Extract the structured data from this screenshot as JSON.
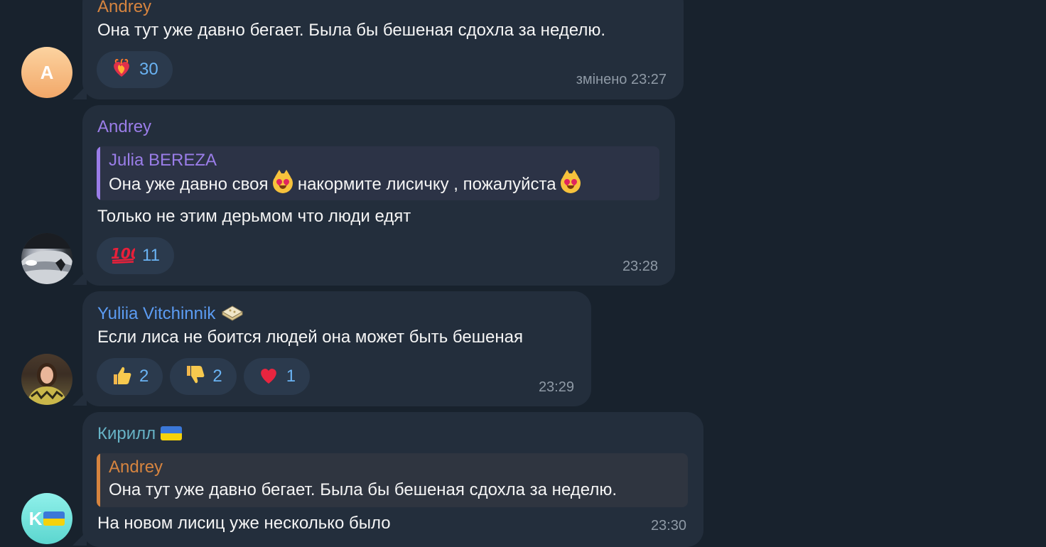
{
  "colors": {
    "background": "#18222d",
    "bubble": "#232e3c",
    "reaction_bg": "#2b3a4d",
    "reaction_count": "#6ab3f3",
    "time": "#8f9aa6",
    "sender_andrey_orange": "#d6843f",
    "sender_andrey_purple": "#9a7de8",
    "sender_yuliia": "#5c9cf3",
    "sender_kirill": "#67b3c6"
  },
  "messages": [
    {
      "sender": "Andrey",
      "text": "Она тут уже давно бегает. Была бы бешеная сдохла за неделю.",
      "avatar_letter": "A",
      "reactions": [
        {
          "emoji_icon": "burning-heart-icon",
          "emoji": "❤‍🔥",
          "count": "30"
        }
      ],
      "time": "змінено 23:27"
    },
    {
      "sender": "Andrey",
      "reply": {
        "author": "Julia BEREZA",
        "text_part1": "Она уже давно своя ",
        "text_part2": "накормите лисичку , пожалуйста "
      },
      "text": "Только не этим дерьмом что люди едят",
      "reactions": [
        {
          "emoji_icon": "hundred-points-icon",
          "emoji": "💯",
          "count": "11"
        }
      ],
      "time": "23:28"
    },
    {
      "sender": "Yuliia Vitchinnik",
      "sender_badge": "🫡",
      "text": "Если лиса не боится людей она может быть бешеная",
      "reactions": [
        {
          "emoji_icon": "thumbs-up-icon",
          "emoji": "👍",
          "count": "2"
        },
        {
          "emoji_icon": "thumbs-down-icon",
          "emoji": "👎",
          "count": "2"
        },
        {
          "emoji_icon": "red-heart-icon",
          "emoji": "❤️",
          "count": "1"
        }
      ],
      "time": "23:29"
    },
    {
      "sender": "Кирилл ",
      "reply": {
        "author": "Andrey",
        "text": "Она тут уже давно бегает. Была бы бешеная сдохла за неделю."
      },
      "text": "На новом лисиц уже несколько было",
      "avatar_letter": "K",
      "time": "23:30"
    }
  ]
}
